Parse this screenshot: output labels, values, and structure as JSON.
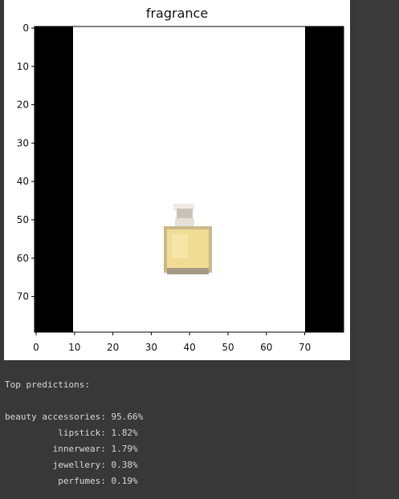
{
  "figure": {
    "title": "fragrance",
    "x_ticks": [
      "0",
      "10",
      "20",
      "30",
      "40",
      "50",
      "60",
      "70"
    ],
    "y_ticks": [
      "0",
      "10",
      "20",
      "30",
      "40",
      "50",
      "60",
      "70"
    ],
    "image_description_icon": "perfume-bottle"
  },
  "output": {
    "header": "Top predictions:",
    "predictions": [
      {
        "label": "beauty accessories",
        "value": "95.66%"
      },
      {
        "label": "lipstick",
        "value": "1.82%"
      },
      {
        "label": "innerwear",
        "value": "1.79%"
      },
      {
        "label": "jewellery",
        "value": "0.38%"
      },
      {
        "label": "perfumes",
        "value": "0.19%"
      }
    ]
  },
  "colors": {
    "background": "#383838",
    "text": "#d8d8d8",
    "bottle": "#e8d590"
  }
}
